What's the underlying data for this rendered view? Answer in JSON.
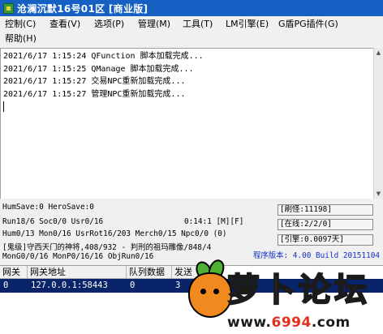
{
  "window": {
    "title": "沧澜沉默16号01区  [商业版]"
  },
  "menu": [
    "控制(C)",
    "查看(V)",
    "选项(P)",
    "管理(M)",
    "工具(T)",
    "LM引擎(E)",
    "G盾PG插件(G)",
    "帮助(H)"
  ],
  "log_lines": [
    "2021/6/17 1:15:24 QFunction 脚本加载完成...",
    "2021/6/17 1:15:25 QManage 脚本加载完成...",
    "2021/6/17 1:15:27 交易NPC重新加载完成...",
    "2021/6/17 1:15:27 管理NPC重新加载完成..."
  ],
  "status": {
    "line1": "HumSave:0 HeroSave:0",
    "line2": "Run18/6 Soc0/0 Usr0/16",
    "time": "0:14:1 [M][F]",
    "line3": "Hum0/13 Mon0/16 UsrRot16/203 Merch0/15 Npc0/0 (0)",
    "line4": "[鬼级]守西天门的神将,408/932 - 判刑的祖玛雕像/848/4",
    "line5": "MonG0/0/16 MonP0/16/16 ObjRun0/16"
  },
  "side_panel": {
    "refresh": "[刷怪:11198]",
    "online": "[在线:2/2/0]",
    "engine": "[引擎:0.0097天]"
  },
  "version": "程序版本: 4.00 Build 20151104",
  "table": {
    "headers": [
      "网关",
      "网关地址",
      "队列数据",
      "发送"
    ],
    "rows": [
      [
        "0",
        "127.0.0.1:58443",
        "0",
        "3"
      ]
    ]
  },
  "watermark": {
    "chars": [
      "萝",
      "卜",
      "论",
      "坛"
    ],
    "url_prefix": "www.",
    "url_num": "6994",
    "url_suffix": ".com"
  },
  "colors": {
    "titlebar": "#1560c2",
    "selected_row": "#0a246a",
    "version_text": "#1530c8",
    "watermark_red": "#e0301e",
    "radish_orange": "#f08a1e",
    "leaf_green": "#4fb031"
  }
}
